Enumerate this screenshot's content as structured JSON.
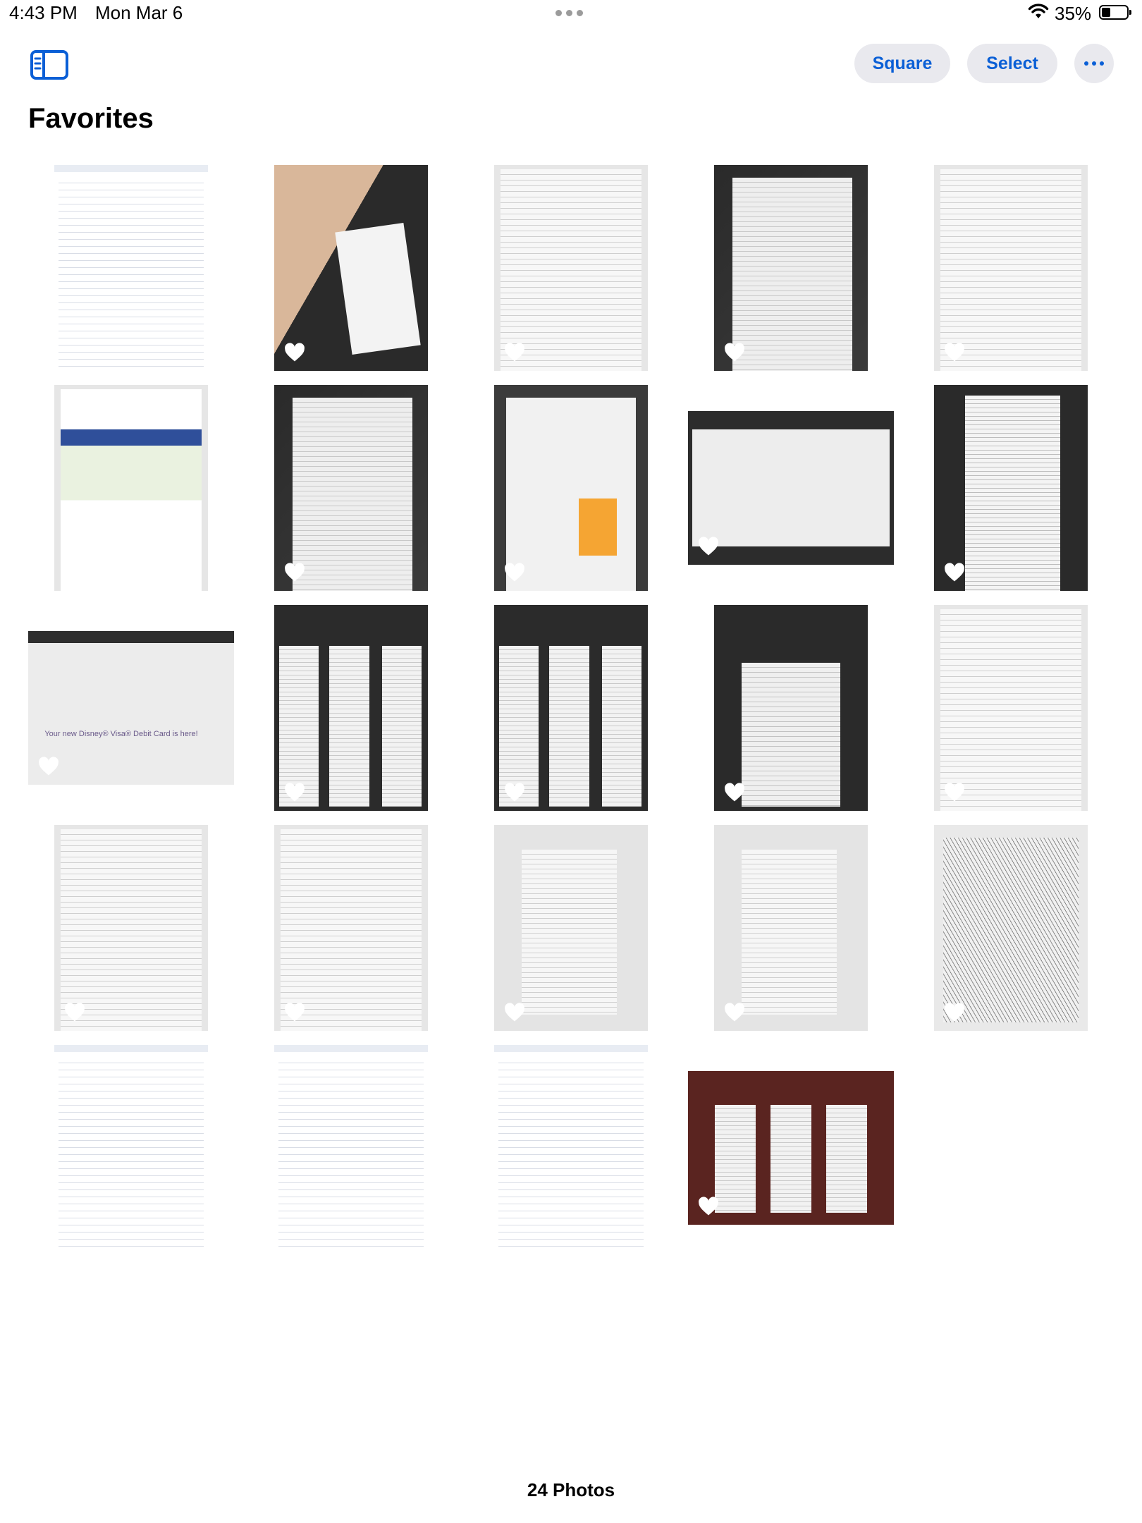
{
  "status_bar": {
    "time": "4:43 PM",
    "date": "Mon Mar 6",
    "battery_percent": "35%"
  },
  "toolbar": {
    "sidebar_icon": "sidebar-icon",
    "square_label": "Square",
    "select_label": "Select",
    "more_icon": "ellipsis-icon"
  },
  "page_title": "Favorites",
  "photos": [
    {
      "kind": "screenshot",
      "orientation": "portrait"
    },
    {
      "kind": "hand-note",
      "orientation": "portrait"
    },
    {
      "kind": "document",
      "orientation": "portrait"
    },
    {
      "kind": "document",
      "orientation": "portrait"
    },
    {
      "kind": "document",
      "orientation": "portrait"
    },
    {
      "kind": "document",
      "orientation": "portrait"
    },
    {
      "kind": "document",
      "orientation": "portrait"
    },
    {
      "kind": "insurance",
      "orientation": "portrait"
    },
    {
      "kind": "check",
      "orientation": "landscape"
    },
    {
      "kind": "walmart-receipt",
      "orientation": "portrait"
    },
    {
      "kind": "chase-card",
      "orientation": "landscape",
      "caption": "Your new Disney® Visa® Debit Card is here!"
    },
    {
      "kind": "receipts",
      "orientation": "portrait"
    },
    {
      "kind": "receipts",
      "orientation": "portrait"
    },
    {
      "kind": "receipt",
      "orientation": "portrait"
    },
    {
      "kind": "registration",
      "orientation": "portrait"
    },
    {
      "kind": "registration",
      "orientation": "portrait"
    },
    {
      "kind": "registration",
      "orientation": "portrait"
    },
    {
      "kind": "usaa-receipt",
      "orientation": "portrait"
    },
    {
      "kind": "usaa-receipt",
      "orientation": "portrait"
    },
    {
      "kind": "notes",
      "orientation": "portrait"
    },
    {
      "kind": "screenshot",
      "orientation": "portrait"
    },
    {
      "kind": "screenshot",
      "orientation": "portrait"
    },
    {
      "kind": "screenshot",
      "orientation": "portrait"
    },
    {
      "kind": "receipts-red",
      "orientation": "landscape"
    }
  ],
  "footer": {
    "photo_count": "24 Photos"
  }
}
